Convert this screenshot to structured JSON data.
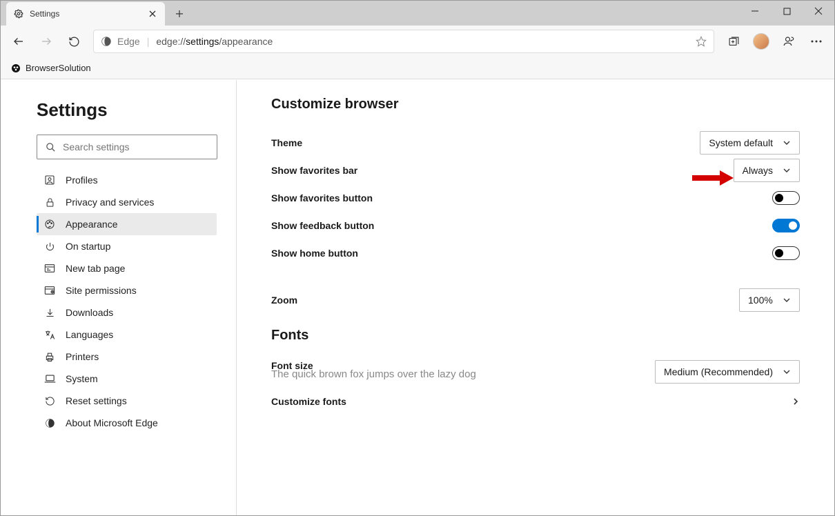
{
  "window": {
    "tab_title": "Settings"
  },
  "toolbar": {
    "brand": "Edge",
    "url_prefix": "edge://",
    "url_strong": "settings",
    "url_suffix": "/appearance"
  },
  "bookmarks": {
    "item1": "BrowserSolution"
  },
  "sidebar": {
    "title": "Settings",
    "search_placeholder": "Search settings",
    "items": [
      {
        "label": "Profiles"
      },
      {
        "label": "Privacy and services"
      },
      {
        "label": "Appearance"
      },
      {
        "label": "On startup"
      },
      {
        "label": "New tab page"
      },
      {
        "label": "Site permissions"
      },
      {
        "label": "Downloads"
      },
      {
        "label": "Languages"
      },
      {
        "label": "Printers"
      },
      {
        "label": "System"
      },
      {
        "label": "Reset settings"
      },
      {
        "label": "About Microsoft Edge"
      }
    ]
  },
  "main": {
    "heading": "Customize browser",
    "theme_label": "Theme",
    "theme_value": "System default",
    "favbar_label": "Show favorites bar",
    "favbar_value": "Always",
    "favbtn_label": "Show favorites button",
    "feedback_label": "Show feedback button",
    "homebtn_label": "Show home button",
    "zoom_label": "Zoom",
    "zoom_value": "100%",
    "fonts_heading": "Fonts",
    "fontsize_label": "Font size",
    "fontsize_value": "Medium (Recommended)",
    "fontsample": "The quick brown fox jumps over the lazy dog",
    "customfonts_label": "Customize fonts"
  }
}
